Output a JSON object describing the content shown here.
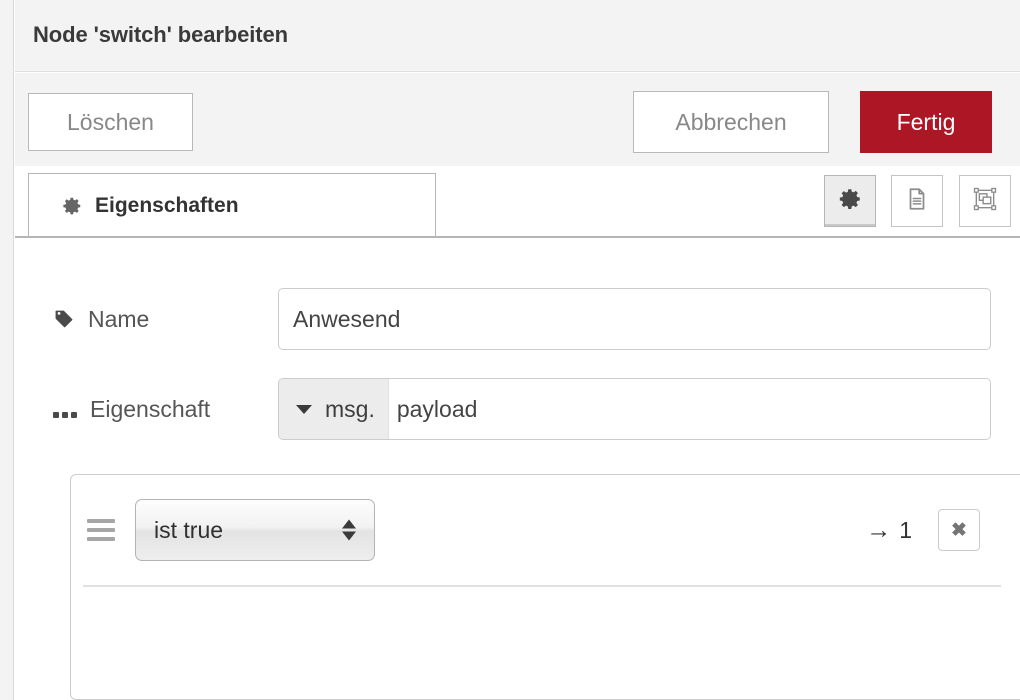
{
  "dialog": {
    "title": "Node 'switch' bearbeiten",
    "actions": {
      "delete_label": "Löschen",
      "cancel_label": "Abbrechen",
      "done_label": "Fertig"
    },
    "accent_color": "#ad1625",
    "header_bg": "#f3f3f3"
  },
  "tabs": [
    {
      "label": "Eigenschaften",
      "icon": "gear-icon",
      "active": true
    }
  ],
  "tab_toolbar": [
    {
      "name": "node-settings",
      "icon": "gear-icon",
      "active": true
    },
    {
      "name": "node-description",
      "icon": "document-icon",
      "active": false
    },
    {
      "name": "node-appearance",
      "icon": "appearance-icon",
      "active": false
    }
  ],
  "form": {
    "name_row": {
      "icon": "tag-icon",
      "label": "Name",
      "value": "Anwesend",
      "placeholder": "Name"
    },
    "property_row": {
      "icon": "ellipsis-icon",
      "label": "Eigenschaft",
      "type_prefix": "msg.",
      "value": "payload",
      "placeholder": "payload"
    }
  },
  "rules": [
    {
      "handle": "drag-handle-icon",
      "operator": "ist true",
      "output_arrow": "→",
      "output_index": "1",
      "delete_glyph": "✖"
    }
  ]
}
